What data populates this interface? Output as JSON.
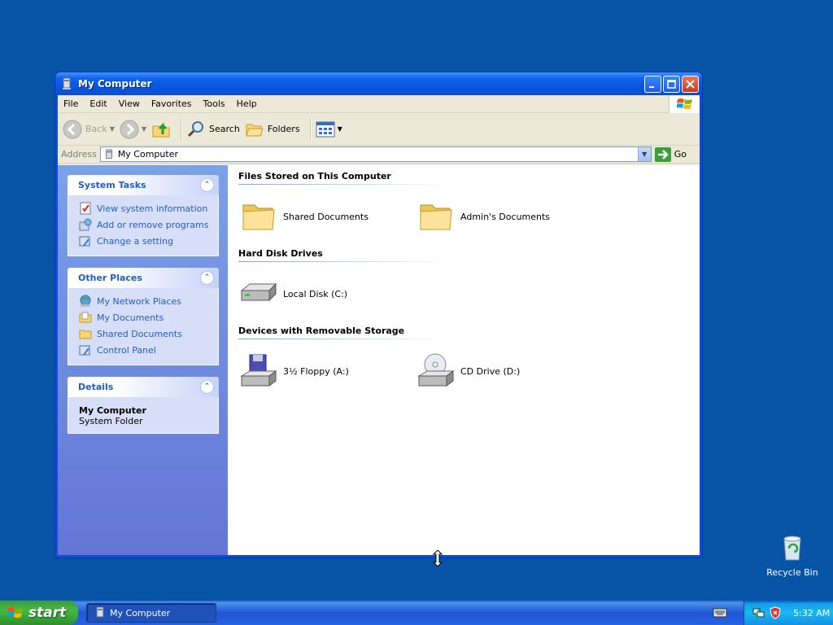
{
  "window": {
    "title": "My Computer",
    "controls": [
      "minimize-icon",
      "maximize-icon",
      "close-icon"
    ]
  },
  "menu": [
    "File",
    "Edit",
    "View",
    "Favorites",
    "Tools",
    "Help"
  ],
  "toolbar": {
    "back": "Back",
    "search": "Search",
    "folders": "Folders"
  },
  "address": {
    "label": "Address",
    "value": "My Computer",
    "go": "Go"
  },
  "taskpane": {
    "system_tasks": {
      "title": "System Tasks",
      "links": [
        "View system information",
        "Add or remove programs",
        "Change a setting"
      ]
    },
    "other_places": {
      "title": "Other Places",
      "links": [
        "My Network Places",
        "My Documents",
        "Shared Documents",
        "Control Panel"
      ]
    },
    "details": {
      "title": "Details",
      "name": "My Computer",
      "type": "System Folder"
    }
  },
  "groups": [
    {
      "title": "Files Stored on This Computer",
      "items": [
        "Shared Documents",
        "Admin's Documents"
      ]
    },
    {
      "title": "Hard Disk Drives",
      "items": [
        "Local Disk (C:)"
      ]
    },
    {
      "title": "Devices with Removable Storage",
      "items": [
        "3½ Floppy (A:)",
        "CD Drive (D:)"
      ]
    }
  ],
  "desktop": {
    "recycle_bin": "Recycle Bin"
  },
  "taskbar": {
    "start": "start",
    "task": "My Computer",
    "clock": "5:32 AM"
  },
  "colors": {
    "desktop": "#0855a8",
    "title_bar": "#0a55e0",
    "link": "#215dc6",
    "taskpane": "#7ba2e7"
  }
}
